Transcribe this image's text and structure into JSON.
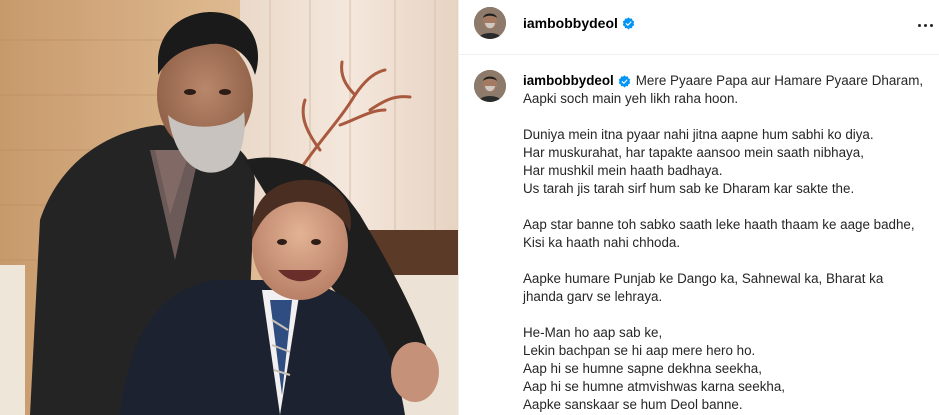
{
  "post": {
    "username": "iambobbydeol",
    "verified": true,
    "header_more_icon": "more-horizontal-icon",
    "caption": {
      "first_line": "Mere Pyaare Papa aur Hamare Pyaare Dharam,",
      "paragraphs": [
        [
          "Aapki soch main yeh likh raha hoon."
        ],
        [
          "Duniya mein itna pyaar nahi jitna aapne hum sabhi ko diya.",
          "Har muskurahat, har tapakte aansoo mein saath nibhaya,",
          "Har mushkil mein haath badhaya.",
          "Us tarah jis tarah sirf hum sab ke Dharam kar sakte the."
        ],
        [
          "Aap star banne toh sabko saath leke haath thaam ke aage badhe,",
          "Kisi ka haath nahi chhoda."
        ],
        [
          "Aapke humare Punjab ke Dango ka, Sahnewal ka, Bharat ka",
          "jhanda garv se lehraya."
        ],
        [
          "He-Man ho aap sab ke,",
          "Lekin bachpan se hi aap mere hero ho.",
          "Aap hi se humne sapne dekhna seekha,",
          "Aap hi se humne atmvishwas karna seekha,",
          "Aapke sanskaar se hum Deol banne."
        ]
      ]
    }
  },
  "colors": {
    "verified": "#0095f6",
    "text": "#262626",
    "border": "#efefef"
  }
}
